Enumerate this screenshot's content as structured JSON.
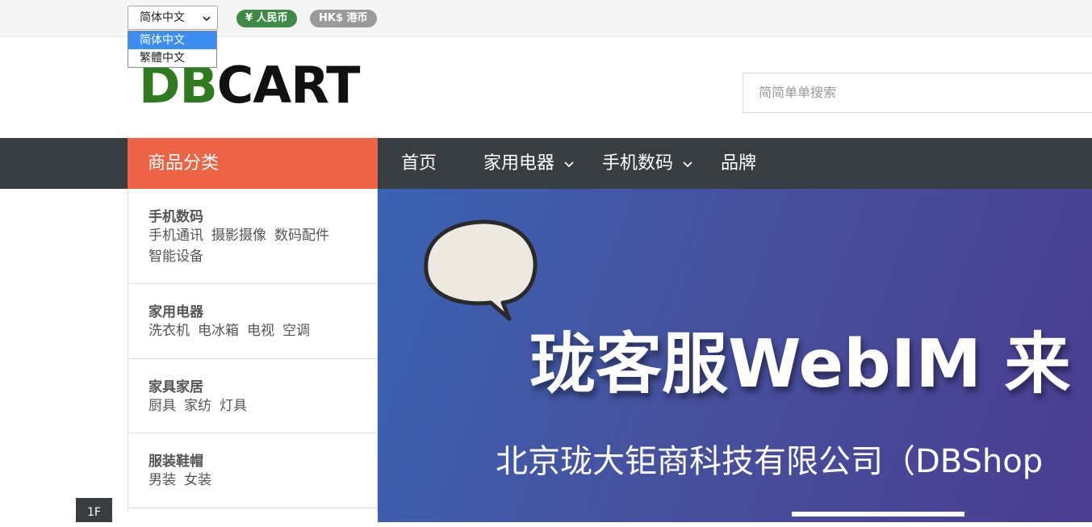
{
  "topbar": {
    "language": {
      "selected": "简体中文",
      "options": [
        "简体中文",
        "繁體中文"
      ]
    },
    "currencies": [
      {
        "label": "¥ 人民币",
        "color": "#3f8b46"
      },
      {
        "label": "HK$ 港币",
        "color": "#9a9a9a"
      }
    ]
  },
  "header": {
    "logo": {
      "part1": "DB",
      "part2": "CART"
    },
    "search_placeholder": "简简单单搜索"
  },
  "nav": {
    "category_title": "商品分类",
    "items": [
      {
        "label": "首页",
        "has_dropdown": false
      },
      {
        "label": "家用电器",
        "has_dropdown": true
      },
      {
        "label": "手机数码",
        "has_dropdown": true
      },
      {
        "label": "品牌",
        "has_dropdown": false
      }
    ]
  },
  "categories": [
    {
      "title": "手机数码",
      "links": [
        "手机通讯",
        "摄影摄像",
        "数码配件",
        "智能设备"
      ]
    },
    {
      "title": "家用电器",
      "links": [
        "洗衣机",
        "电冰箱",
        "电视",
        "空调"
      ]
    },
    {
      "title": "家具家居",
      "links": [
        "厨具",
        "家纺",
        "灯具"
      ]
    },
    {
      "title": "服装鞋帽",
      "links": [
        "男装",
        "女装"
      ]
    }
  ],
  "banner": {
    "title": "珑客服WebIM 来",
    "subtitle": "北京珑大钜商科技有限公司（DBShop"
  },
  "floor": {
    "label": "1F"
  },
  "colors": {
    "brand_green": "#2f7a1f",
    "nav_bg": "#373d40",
    "category_orange": "#ec6345"
  }
}
